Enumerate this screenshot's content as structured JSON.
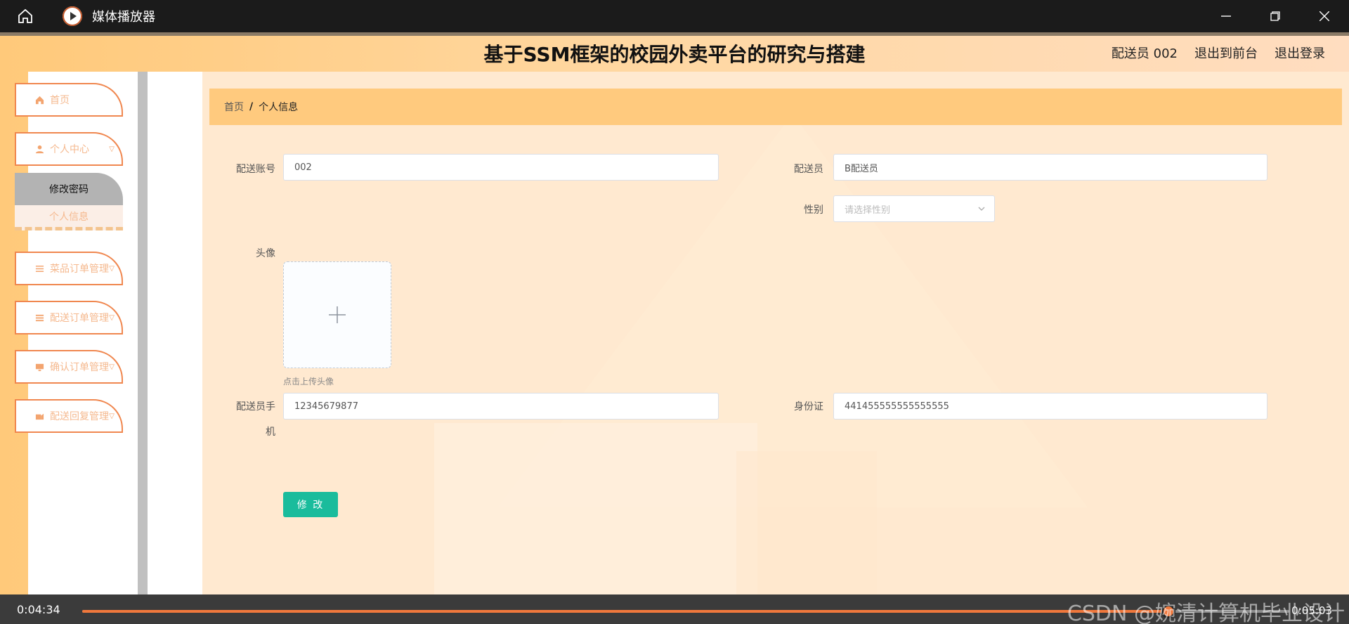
{
  "window": {
    "app_title": "媒体播放器",
    "icons": {
      "home": "home-icon",
      "app": "play-icon",
      "minimize": "minimize-icon",
      "restore": "restore-icon",
      "close": "close-icon"
    }
  },
  "header": {
    "site_title": "基于SSM框架的校园外卖平台的研究与搭建",
    "user_label": "配送员 002",
    "front_link": "退出到前台",
    "logout_link": "退出登录"
  },
  "sidebar": {
    "items": [
      {
        "label": "首页",
        "icon": "home-icon"
      },
      {
        "label": "个人中心",
        "icon": "user-icon"
      },
      {
        "label": "菜品订单管理",
        "icon": "list-icon"
      },
      {
        "label": "配送订单管理",
        "icon": "menu-icon"
      },
      {
        "label": "确认订单管理",
        "icon": "monitor-icon"
      },
      {
        "label": "配送回复管理",
        "icon": "message-icon"
      }
    ],
    "submenu": {
      "active": "修改密码",
      "other": "个人信息"
    }
  },
  "breadcrumb": {
    "home": "首页",
    "separator": "/",
    "current": "个人信息"
  },
  "form": {
    "account_label": "配送账号",
    "account_value": "002",
    "courier_label": "配送员",
    "courier_value": "B配送员",
    "gender_label": "性别",
    "gender_placeholder": "请选择性别",
    "avatar_label": "头像",
    "avatar_tip": "点击上传头像",
    "phone_label_line1": "配送员手",
    "phone_label_line2": "机",
    "phone_value": "12345679877",
    "id_label": "身份证",
    "id_value": "441455555555555555",
    "submit_label": "修 改"
  },
  "player": {
    "current_time": "0:04:34",
    "total_time": "0:05:03",
    "progress": 0.9,
    "accent": "#f0783c"
  },
  "watermark": "CSDN @婉清计算机毕业设计",
  "colors": {
    "header_bg": "#ffc97a",
    "menu_border": "#f0874f",
    "submit_bg": "#1abc9c",
    "breadcrumb_bg": "#ffca7e"
  }
}
